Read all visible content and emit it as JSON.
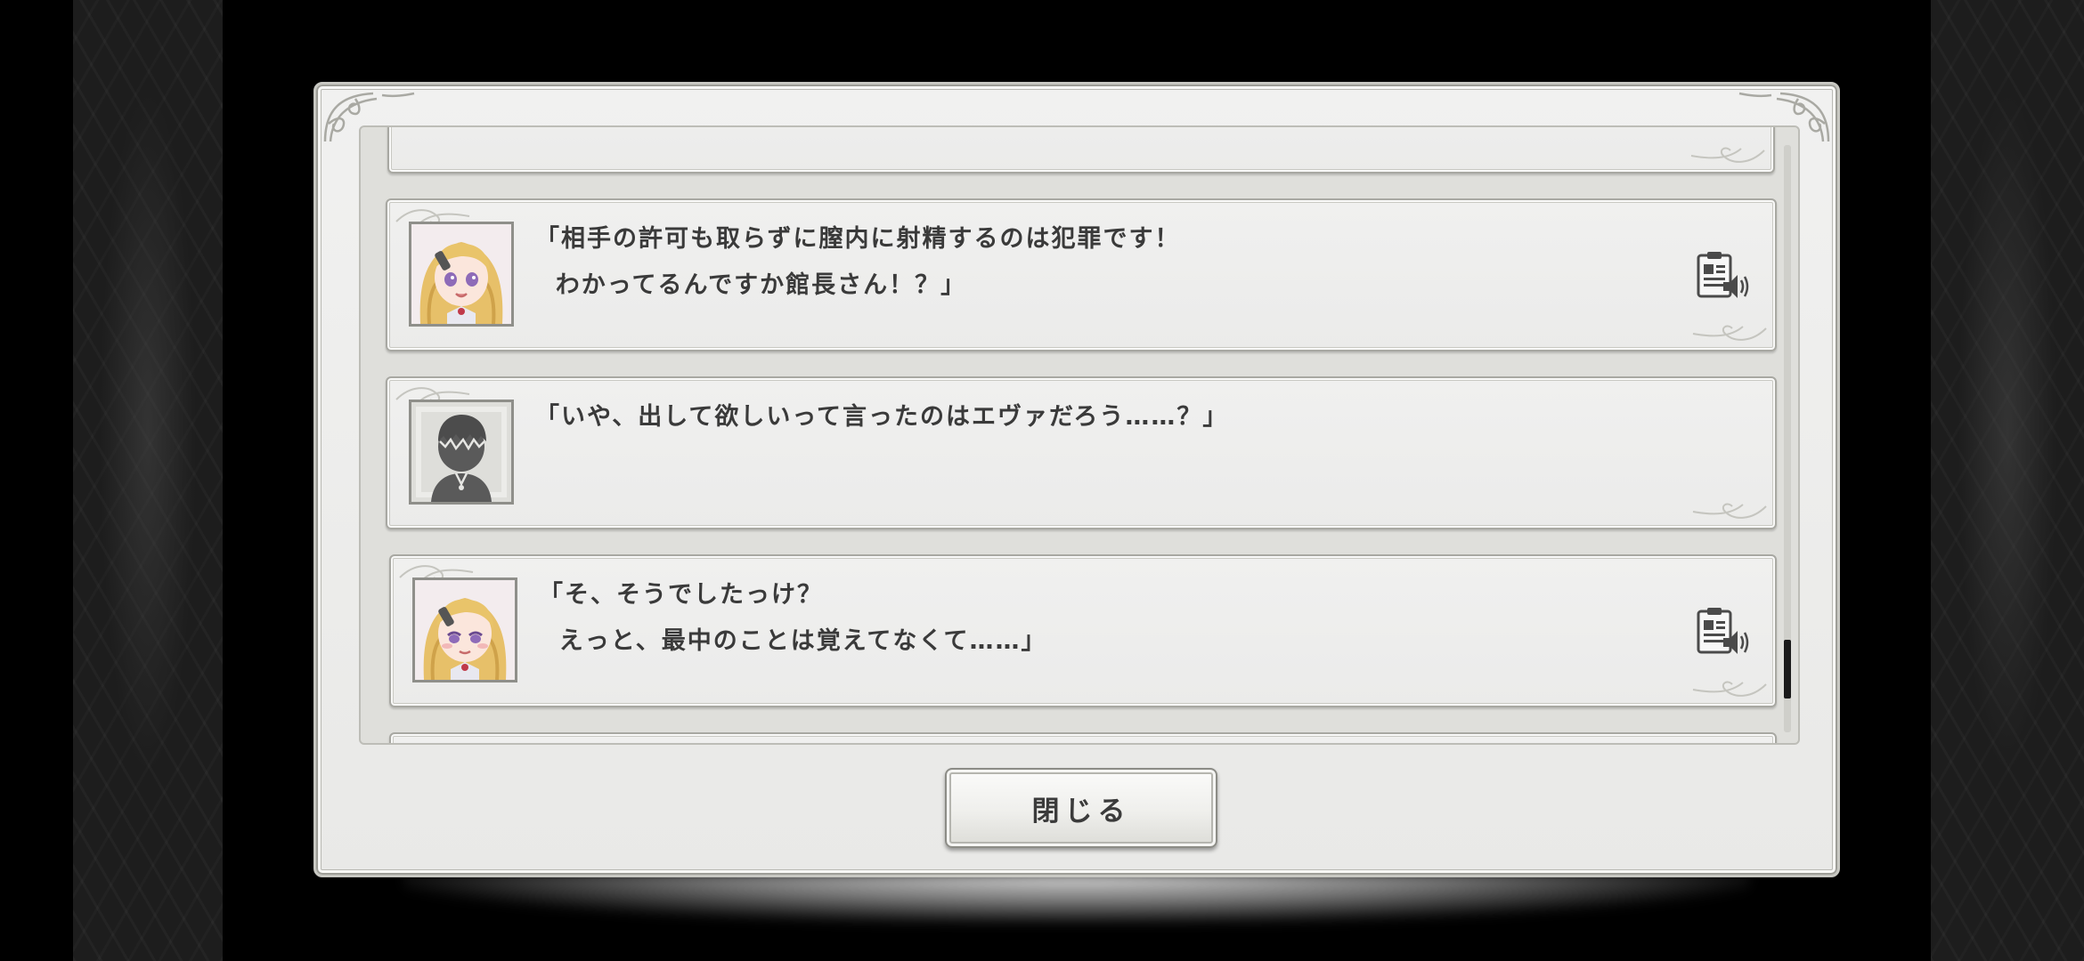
{
  "colors": {
    "background": "#000000",
    "dialog": "#eeeeec",
    "entry": "#efefee",
    "text": "#3a3a3a",
    "scroll_thumb": "#1a1a1a",
    "avatar_hair": "#e9c46a",
    "avatar_eyes": "#8e6bb8"
  },
  "icons": {
    "voice": "voice-replay-icon",
    "ornament": "filigree-ornament"
  },
  "log": {
    "entries": [
      {
        "speaker": "",
        "lines": [],
        "avatar": "none",
        "voice": false
      },
      {
        "speaker": "",
        "lines": [
          "「相手の許可も取らずに膣内に射精するのは犯罪です！",
          "  わかってるんですか館長さん！？」"
        ],
        "avatar": "blonde-girl",
        "voice": true
      },
      {
        "speaker": "",
        "lines": [
          "「いや、出して欲しいって言ったのはエヴァだろう……？」"
        ],
        "avatar": "silhouette",
        "voice": false
      },
      {
        "speaker": "",
        "lines": [
          "「そ、そうでしたっけ？",
          "  えっと、最中のことは覚えてなくて……」"
        ],
        "avatar": "blonde-girl",
        "voice": true
      }
    ]
  },
  "close_button": {
    "label": "閉じる"
  }
}
